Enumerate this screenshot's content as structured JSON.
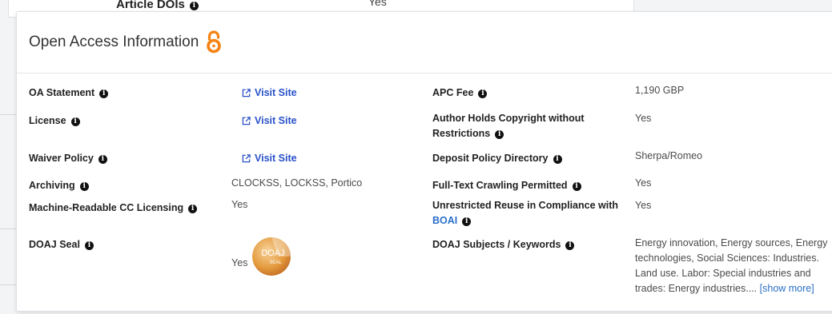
{
  "background": {
    "label": "Article DOIs",
    "value": "Yes"
  },
  "card": {
    "title": "Open Access Information",
    "logo": "open-access-icon",
    "accent": "#f68212"
  },
  "left": {
    "oa_statement": {
      "label": "OA Statement",
      "link": "Visit Site"
    },
    "license": {
      "label": "License",
      "link": "Visit Site"
    },
    "waiver_policy": {
      "label": "Waiver Policy",
      "link": "Visit Site"
    },
    "archiving": {
      "label": "Archiving",
      "value": "CLOCKSS, LOCKSS, Portico"
    },
    "machine_readable": {
      "label": "Machine-Readable CC Licensing",
      "value": "Yes"
    },
    "doaj_seal": {
      "label": "DOAJ Seal",
      "value": "Yes",
      "seal_text_1": "DOAJ",
      "seal_text_2": "SEAL"
    }
  },
  "right": {
    "apc_fee": {
      "label": "APC Fee",
      "value": "1,190 GBP"
    },
    "author_copyright": {
      "label_line1": "Author Holds Copyright without",
      "label_line2": "Restrictions",
      "value": "Yes"
    },
    "deposit_policy": {
      "label": "Deposit Policy Directory",
      "value": "Sherpa/Romeo"
    },
    "full_text": {
      "label": "Full-Text Crawling Permitted",
      "value": "Yes"
    },
    "unrestricted": {
      "label_line1": "Unrestricted Reuse in Compliance with",
      "label_link": "BOAI",
      "value": "Yes"
    },
    "subjects": {
      "label": "DOAJ Subjects / Keywords",
      "line1": "Energy innovation, Energy sources, Energy",
      "line2": "technologies, Social Sciences: Industries.",
      "line3": "Land use. Labor: Special industries and",
      "line4": "trades: Energy industries....",
      "show_more": "[show more]"
    }
  },
  "info_glyph": "i"
}
